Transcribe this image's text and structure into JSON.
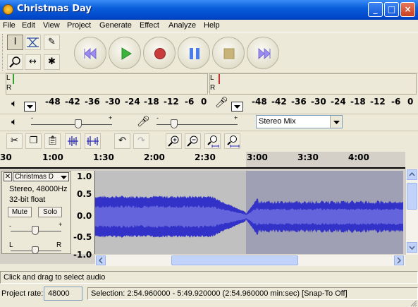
{
  "window": {
    "title": "Christmas Day",
    "min": "_",
    "max": "□",
    "close": "×"
  },
  "menu": [
    "File",
    "Edit",
    "View",
    "Project",
    "Generate",
    "Effect",
    "Analyze",
    "Help"
  ],
  "meter": {
    "left_label": "L",
    "right_label": "R",
    "scale": [
      "-48",
      "-42",
      "-36",
      "-30",
      "-24",
      "-18",
      "-12",
      "-6",
      "0"
    ]
  },
  "mixer": {
    "input_source": "Stereo Mix",
    "minus": "-",
    "plus": "+"
  },
  "timeline": {
    "ticks": [
      "30",
      "1:00",
      "1:30",
      "2:00",
      "2:30",
      "3:00",
      "3:30",
      "4:00"
    ]
  },
  "track": {
    "name": "Christmas D",
    "format": "Stereo, 48000Hz",
    "bits": "32-bit float",
    "mute": "Mute",
    "solo": "Solo",
    "gain_minus": "-",
    "gain_plus": "+",
    "pan_left": "L",
    "pan_right": "R",
    "vscale": [
      "1.0",
      "0.5",
      "0.0",
      "-0.5",
      "-1.0"
    ]
  },
  "status": {
    "hint": "Click and drag to select audio",
    "rate_label": "Project rate:",
    "rate_value": "48000",
    "selection": "Selection: 2:54.960000 - 5:49.920000 (2:54.960000 min:sec)   [Snap-To Off]"
  },
  "colors": {
    "wave": "#3232C8",
    "wave_light": "#6464DC",
    "selected_bg": "#A0A0B4",
    "unselected_bg": "#C0C0C0",
    "title_bar": "#0A5FDB"
  }
}
